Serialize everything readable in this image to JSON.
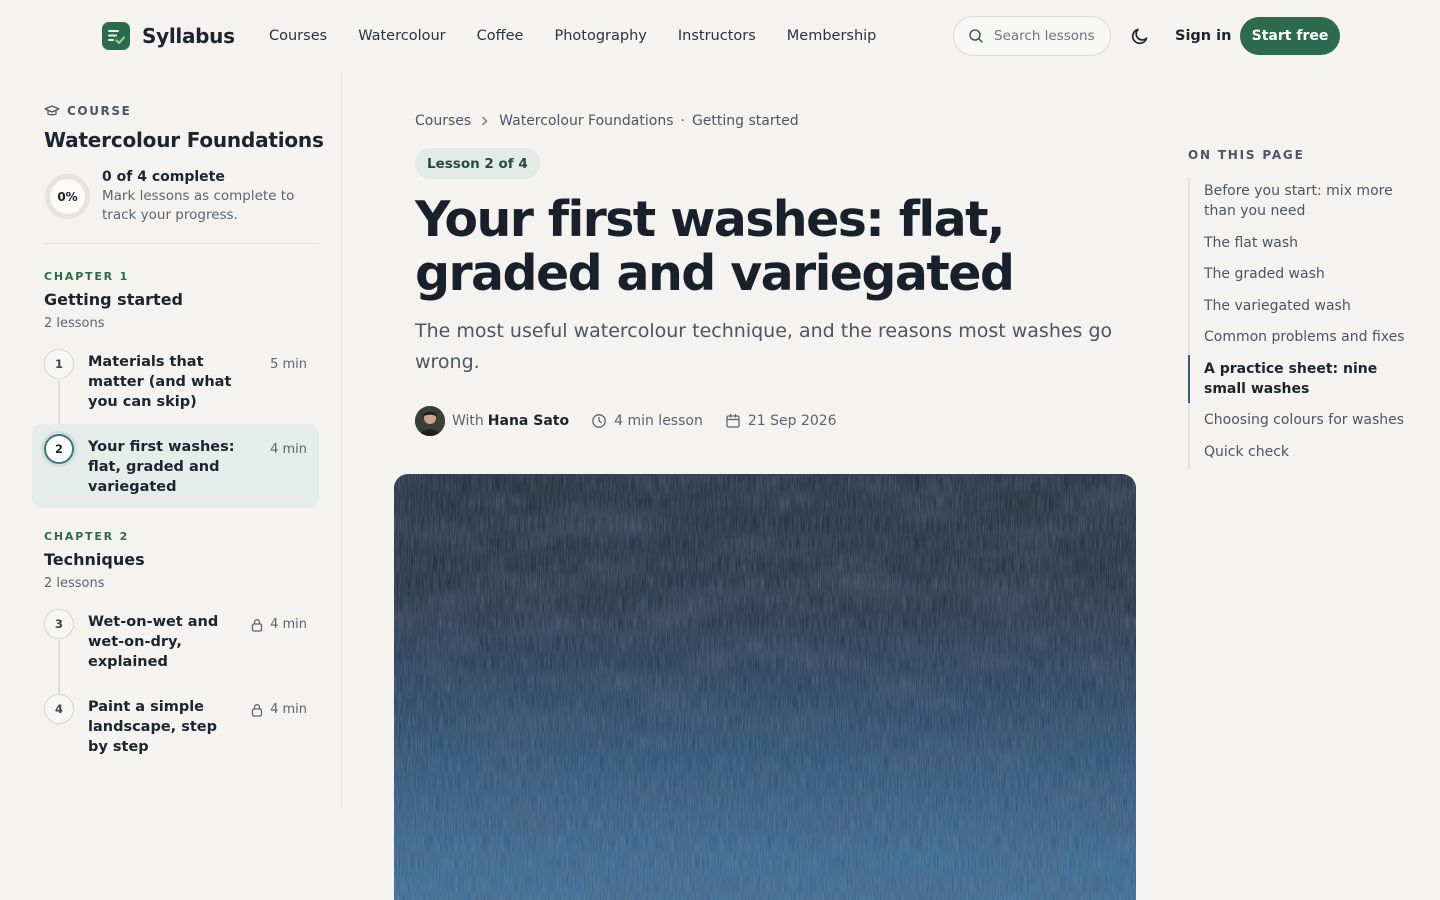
{
  "brand": {
    "name": "Syllabus",
    "accent": "#2d6a4f"
  },
  "nav": {
    "items": [
      "Courses",
      "Watercolour",
      "Coffee",
      "Photography",
      "Instructors",
      "Membership"
    ]
  },
  "search": {
    "placeholder": "Search lessons"
  },
  "header": {
    "sign_in": "Sign in",
    "start_free": "Start free"
  },
  "sidebar": {
    "eyebrow": "COURSE",
    "course_title": "Watercolour Foundations",
    "progress": {
      "percent_label": "0%",
      "percent": 0,
      "count": "0 of 4 complete",
      "hint": "Mark lessons as complete to track your progress."
    },
    "chapters": [
      {
        "eyebrow": "CHAPTER 1",
        "title": "Getting started",
        "count": "2 lessons",
        "lessons": [
          {
            "num": "1",
            "title": "Materials that matter (and what you can skip)",
            "duration": "5 min",
            "locked": false,
            "active": false
          },
          {
            "num": "2",
            "title": "Your first washes: flat, graded and variegated",
            "duration": "4 min",
            "locked": false,
            "active": true
          }
        ]
      },
      {
        "eyebrow": "CHAPTER 2",
        "title": "Techniques",
        "count": "2 lessons",
        "lessons": [
          {
            "num": "3",
            "title": "Wet-on-wet and wet-on-dry, explained",
            "duration": "4 min",
            "locked": true,
            "active": false
          },
          {
            "num": "4",
            "title": "Paint a simple landscape, step by step",
            "duration": "4 min",
            "locked": true,
            "active": false
          }
        ]
      }
    ]
  },
  "main": {
    "breadcrumb": [
      "Courses",
      "Watercolour Foundations",
      "Getting started"
    ],
    "badge": "Lesson 2 of 4",
    "title": "Your first washes: flat, graded and variegated",
    "subtitle": "The most useful watercolour technique, and the reasons most washes go wrong.",
    "meta": {
      "with": "With",
      "author": "Hana Sato",
      "length": "4 min lesson",
      "date": "21 Sep 2026"
    }
  },
  "toc": {
    "heading": "ON THIS PAGE",
    "items": [
      {
        "label": "Before you start: mix more than you need",
        "active": false
      },
      {
        "label": "The flat wash",
        "active": false
      },
      {
        "label": "The graded wash",
        "active": false
      },
      {
        "label": "The variegated wash",
        "active": false
      },
      {
        "label": "Common problems and fixes",
        "active": false
      },
      {
        "label": "A practice sheet: nine small washes",
        "active": true
      },
      {
        "label": "Choosing colours for washes",
        "active": false
      },
      {
        "label": "Quick check",
        "active": false
      }
    ]
  }
}
